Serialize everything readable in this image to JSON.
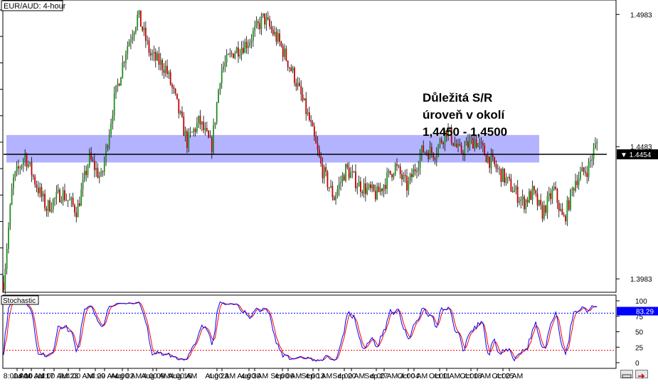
{
  "chart_data": [
    {
      "type": "candlestick",
      "title": "EUR/AUD: 4-hour",
      "ylim": [
        1.3935,
        1.5035
      ],
      "y_ticks": [
        {
          "value": 1.4983,
          "label": "1.4983"
        },
        {
          "value": 1.4483,
          "label": "1.4483"
        },
        {
          "value": 1.3983,
          "label": "1.3983"
        }
      ],
      "current_price": {
        "value": 1.4454,
        "label": "1.4454"
      },
      "sr_zone": {
        "low": 1.4423,
        "high": 1.4527
      },
      "x_labels": [
        "8:00 AM",
        "Jul 10",
        "4:00 AM",
        "Jul 17",
        "4:00 AM",
        "Jul 23",
        "4:00 AM",
        "Jul 29",
        "4:00 AM",
        "Aug 02",
        "4:00 AM",
        "Aug 09",
        "4:00 AM",
        "Aug 16",
        "4:00 AM",
        "Aug 23",
        "4:00 AM",
        "Aug 30",
        "4:00 AM",
        "Sep 06",
        "4:00 AM",
        "Sep 13",
        "4:00 AM",
        "Sep 20",
        "4:00 AM",
        "Sep 27",
        "4:00 AM",
        "Oct 04",
        "4:00 AM",
        "Oct 11",
        "4:00 AM",
        "Oct 18",
        "4:00 AM",
        "Oct 25",
        "4:00 AM"
      ],
      "price_path": [
        [
          0,
          1.397
        ],
        [
          1.5,
          1.435
        ],
        [
          3.5,
          1.445
        ],
        [
          5,
          1.436
        ],
        [
          7,
          1.425
        ],
        [
          9.5,
          1.431
        ],
        [
          12,
          1.424
        ],
        [
          14,
          1.444
        ],
        [
          16,
          1.436
        ],
        [
          18,
          1.465
        ],
        [
          20,
          1.485
        ],
        [
          22,
          1.498
        ],
        [
          24,
          1.483
        ],
        [
          26.5,
          1.478
        ],
        [
          28,
          1.467
        ],
        [
          30,
          1.45
        ],
        [
          32,
          1.458
        ],
        [
          34,
          1.448
        ],
        [
          35.5,
          1.477
        ],
        [
          37.5,
          1.484
        ],
        [
          40,
          1.488
        ],
        [
          42.5,
          1.497
        ],
        [
          45,
          1.488
        ],
        [
          47.5,
          1.475
        ],
        [
          50,
          1.458
        ],
        [
          52,
          1.44
        ],
        [
          54,
          1.429
        ],
        [
          56,
          1.44
        ],
        [
          58,
          1.434
        ],
        [
          61,
          1.43
        ],
        [
          64,
          1.441
        ],
        [
          66,
          1.433
        ],
        [
          68.5,
          1.447
        ],
        [
          70.5,
          1.446
        ],
        [
          72.5,
          1.455
        ],
        [
          74.5,
          1.446
        ],
        [
          77,
          1.451
        ],
        [
          79.5,
          1.443
        ],
        [
          82,
          1.436
        ],
        [
          85,
          1.427
        ],
        [
          86.5,
          1.431
        ],
        [
          88,
          1.423
        ],
        [
          90,
          1.432
        ],
        [
          91.5,
          1.42
        ],
        [
          93.5,
          1.436
        ],
        [
          95.5,
          1.44
        ],
        [
          97,
          1.45
        ]
      ],
      "stochastic": {
        "name": "Stochastic",
        "ylim": [
          0,
          100
        ],
        "y_ticks": [
          100,
          75,
          50,
          25,
          0
        ],
        "levels": [
          80,
          20
        ],
        "current_value": {
          "value": 83.29,
          "label": "83.29"
        },
        "k_color": "#0000ff",
        "d_color": "#ff0000"
      },
      "colors": {
        "bull": "#1f8f1f",
        "bear": "#c00000",
        "zone": "#9999ff",
        "grid": "#000000"
      },
      "annotation": [
        "Důležitá S/R",
        "úroveň v okolí",
        "1,4450 - 1,4500"
      ]
    }
  ]
}
